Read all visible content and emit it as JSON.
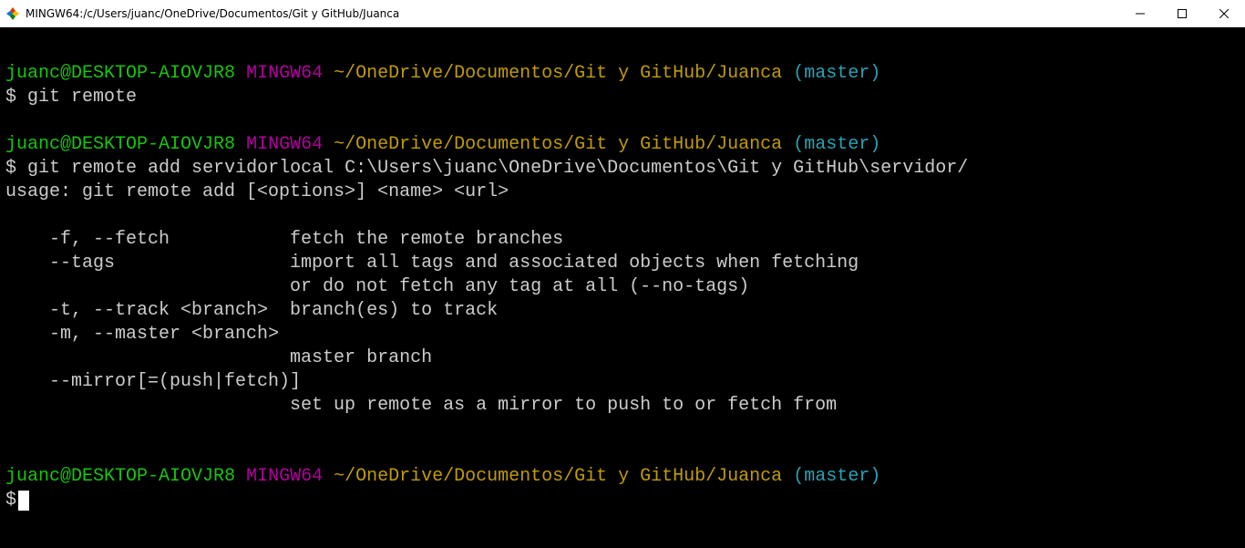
{
  "titlebar": {
    "title": "MINGW64:/c/Users/juanc/OneDrive/Documentos/Git y GitHub/Juanca"
  },
  "prompt": {
    "user_host": "juanc@DESKTOP-AIOVJR8",
    "env": "MINGW64",
    "path": "~/OneDrive/Documentos/Git y GitHub/Juanca",
    "branch": "(master)",
    "symbol": "$"
  },
  "block1": {
    "command": "git remote"
  },
  "block2": {
    "command": "git remote add servidorlocal C:\\Users\\juanc\\OneDrive\\Documentos\\Git y GitHub\\servidor/",
    "out1": "usage: git remote add [<options>] <name> <url>",
    "out2": "    -f, --fetch           fetch the remote branches",
    "out3": "    --tags                import all tags and associated objects when fetching",
    "out4": "                          or do not fetch any tag at all (--no-tags)",
    "out5": "    -t, --track <branch>  branch(es) to track",
    "out6": "    -m, --master <branch>",
    "out7": "                          master branch",
    "out8": "    --mirror[=(push|fetch)]",
    "out9": "                          set up remote as a mirror to push to or fetch from"
  }
}
